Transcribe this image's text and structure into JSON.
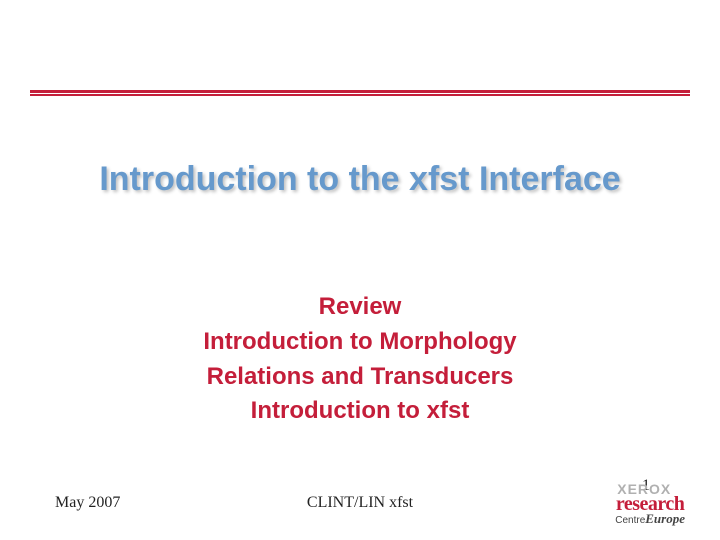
{
  "title": "Introduction to the xfst Interface",
  "subtitles": {
    "line1": "Review",
    "line2": "Introduction to Morphology",
    "line3": "Relations and Transducers",
    "line4": "Introduction to xfst"
  },
  "footer": {
    "date": "May 2007",
    "center": "CLINT/LIN xfst",
    "page": "1"
  },
  "logo": {
    "brand": "XEROX",
    "main": "research",
    "sub_left": "Centre",
    "sub_right": "Europe"
  }
}
